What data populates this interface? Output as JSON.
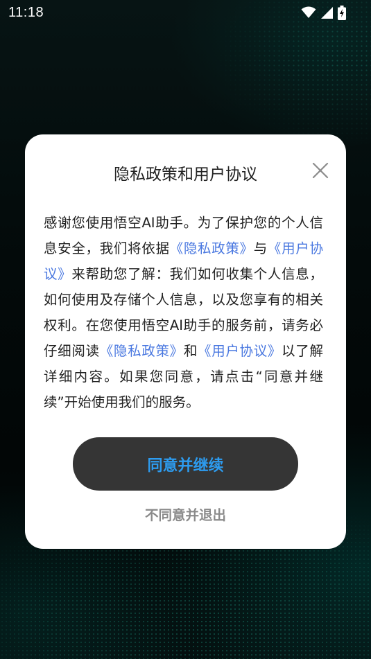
{
  "status_bar": {
    "time": "11:18",
    "icons": [
      "wifi-icon",
      "signal-icon",
      "battery-charging-icon"
    ]
  },
  "dialog": {
    "title": "隐私政策和用户协议",
    "close_icon": "close-icon",
    "body": {
      "p1": "感谢您使用悟空AI助手。为了保护您的个人信息安全，我们将依据",
      "link_privacy_1": "《隐私政策》",
      "p2": "与",
      "link_agreement_1": "《用户协议》",
      "p3": "来帮助您了解：我们如何收集个人信息，如何使用及存储个人信息，以及您享有的相关权利。在您使用悟空AI助手的服务前，请务必仔细阅读",
      "link_privacy_2": "《隐私政策》",
      "p4": "和",
      "link_agreement_2": "《用户协议》",
      "p5": "以了解详细内容。如果您同意，请点击“同意并继续”开始使用我们的服务。"
    },
    "agree_label": "同意并继续",
    "decline_label": "不同意并退出"
  },
  "colors": {
    "link": "#4a78e0",
    "agree_text": "#2d9cf0",
    "agree_bg": "#353535",
    "decline_text": "#8a8a8a"
  }
}
